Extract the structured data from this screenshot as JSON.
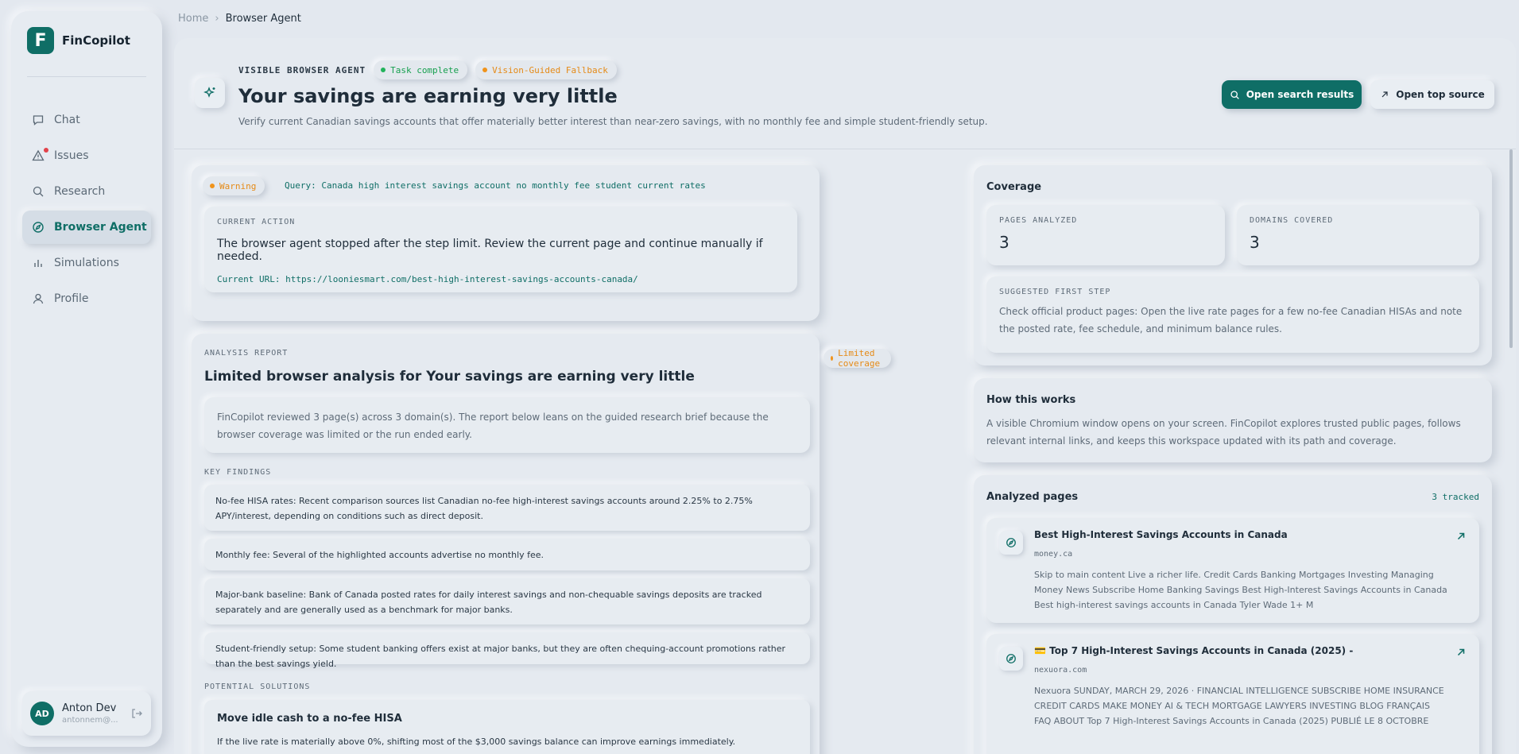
{
  "app": {
    "name": "FinCopilot"
  },
  "sidebar": {
    "items": [
      {
        "label": "Chat",
        "icon": "chat-icon"
      },
      {
        "label": "Issues",
        "icon": "warning-icon"
      },
      {
        "label": "Research",
        "icon": "search-icon"
      },
      {
        "label": "Browser Agent",
        "icon": "compass-icon",
        "active": true
      },
      {
        "label": "Simulations",
        "icon": "bar-chart-icon"
      },
      {
        "label": "Profile",
        "icon": "user-icon"
      }
    ],
    "user": {
      "initials": "AD",
      "name": "Anton Dev",
      "email": "antonnem@..."
    }
  },
  "breadcrumb": {
    "home": "Home",
    "current": "Browser Agent"
  },
  "header": {
    "eyebrow": "VISIBLE BROWSER AGENT",
    "status_pill": "Task complete",
    "mode_pill": "Vision-Guided Fallback",
    "title": "Your savings are earning very little",
    "subtitle": "Verify current Canadian savings accounts that offer materially better interest than near-zero savings, with no monthly fee and simple student-friendly setup.",
    "primary_button": "Open search results",
    "secondary_button": "Open top source"
  },
  "current_action": {
    "warning_label": "Warning",
    "query": "Query: Canada high interest savings account no monthly fee student current rates",
    "heading": "CURRENT ACTION",
    "text": "The browser agent stopped after the step limit. Review the current page and continue manually if needed.",
    "url": "Current URL: https://looniesmart.com/best-high-interest-savings-accounts-canada/"
  },
  "analysis_report": {
    "eyebrow": "ANALYSIS REPORT",
    "coverage_pill": "Limited coverage",
    "title": "Limited browser analysis for Your savings are earning very little",
    "summary": "FinCopilot reviewed 3 page(s) across 3 domain(s). The report below leans on the guided research brief because the browser coverage was limited or the run ended early.",
    "findings_heading": "KEY FINDINGS",
    "findings": [
      "No-fee HISA rates: Recent comparison sources list Canadian no-fee high-interest savings accounts around 2.25% to 2.75% APY/interest, depending on conditions such as direct deposit.",
      "Monthly fee: Several of the highlighted accounts advertise no monthly fee.",
      "Major-bank baseline: Bank of Canada posted rates for daily interest savings and non-chequable savings deposits are tracked separately and are generally used as a benchmark for major banks.",
      "Student-friendly setup: Some student banking offers exist at major banks, but they are often chequing-account promotions rather than the best savings yield."
    ],
    "solutions_heading": "POTENTIAL SOLUTIONS",
    "solutions": [
      {
        "title": "Move idle cash to a no-fee HISA",
        "text": "If the live rate is materially above 0%, shifting most of the $3,000 savings balance can improve earnings immediately."
      }
    ]
  },
  "coverage": {
    "title": "Coverage",
    "pages_label": "PAGES ANALYZED",
    "pages_value": "3",
    "domains_label": "DOMAINS COVERED",
    "domains_value": "3",
    "first_step_label": "SUGGESTED FIRST STEP",
    "first_step_text": "Check official product pages: Open the live rate pages for a few no-fee Canadian HISAs and note the posted rate, fee schedule, and minimum balance rules."
  },
  "how_it_works": {
    "title": "How this works",
    "text": "A visible Chromium window opens on your screen. FinCopilot explores trusted public pages, follows relevant internal links, and keeps this workspace updated with its path and coverage."
  },
  "analyzed_pages": {
    "title": "Analyzed pages",
    "tracked": "3 tracked",
    "items": [
      {
        "title": "Best High-Interest Savings Accounts in Canada",
        "domain": "money.ca",
        "desc": "Skip to main content Live a richer life. Credit Cards Banking Mortgages Investing Managing Money News Subscribe Home Banking Savings Best High-Interest Savings Accounts in Canada Best high-interest savings accounts in Canada Tyler Wade 1+ M"
      },
      {
        "title": "💳 Top 7 High-Interest Savings Accounts in Canada (2025) -",
        "domain": "nexuora.com",
        "desc": "Nexuora SUNDAY, MARCH 29, 2026 · FINANCIAL INTELLIGENCE SUBSCRIBE HOME INSURANCE CREDIT CARDS MAKE MONEY AI & TECH MORTGAGE LAWYERS INVESTING BLOG FRANÇAIS FAQ ABOUT Top 7 High-Interest Savings Accounts in Canada (2025) PUBLIÉ LE 8 OCTOBRE"
      }
    ]
  },
  "colors": {
    "accent": "#0f6e66",
    "success": "#22b35b",
    "warning": "#f0931b"
  }
}
